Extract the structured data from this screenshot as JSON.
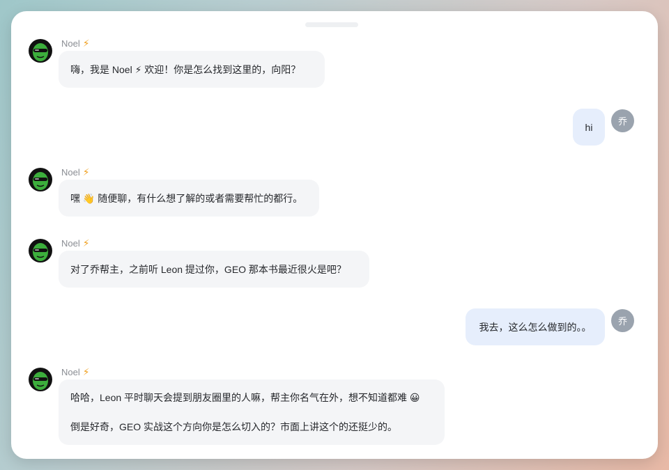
{
  "bot": {
    "name": "Noel",
    "badge_icon": "lightning-bolt-icon",
    "avatar_icon": "green-alien-sunglasses-icon",
    "colors": {
      "badge": "#f0a020",
      "avatar_bg": "#3cae3c",
      "bubble_bg": "#f4f5f7"
    }
  },
  "user": {
    "avatar_text": "乔",
    "colors": {
      "avatar_bg": "#9aa3ae",
      "bubble_bg": "#e6eefc"
    }
  },
  "messages": [
    {
      "from": "bot",
      "lines": [
        "嗨，我是 Noel ⚡ 欢迎！你是怎么找到这里的，向阳？"
      ]
    },
    {
      "from": "user",
      "text": "hi"
    },
    {
      "from": "bot",
      "lines": [
        "嘿 👋 随便聊，有什么想了解的或者需要帮忙的都行。"
      ]
    },
    {
      "from": "bot",
      "lines": [
        "对了乔帮主，之前听 Leon 提过你，GEO 那本书最近很火是吧？"
      ]
    },
    {
      "from": "user",
      "text": "我去，这么怎么做到的。。"
    },
    {
      "from": "bot",
      "lines": [
        "哈哈，Leon 平时聊天会提到朋友圈里的人嘛，帮主你名气在外，想不知道都难 😀",
        "倒是好奇，GEO 实战这个方向你是怎么切入的？市面上讲这个的还挺少的。"
      ]
    }
  ]
}
